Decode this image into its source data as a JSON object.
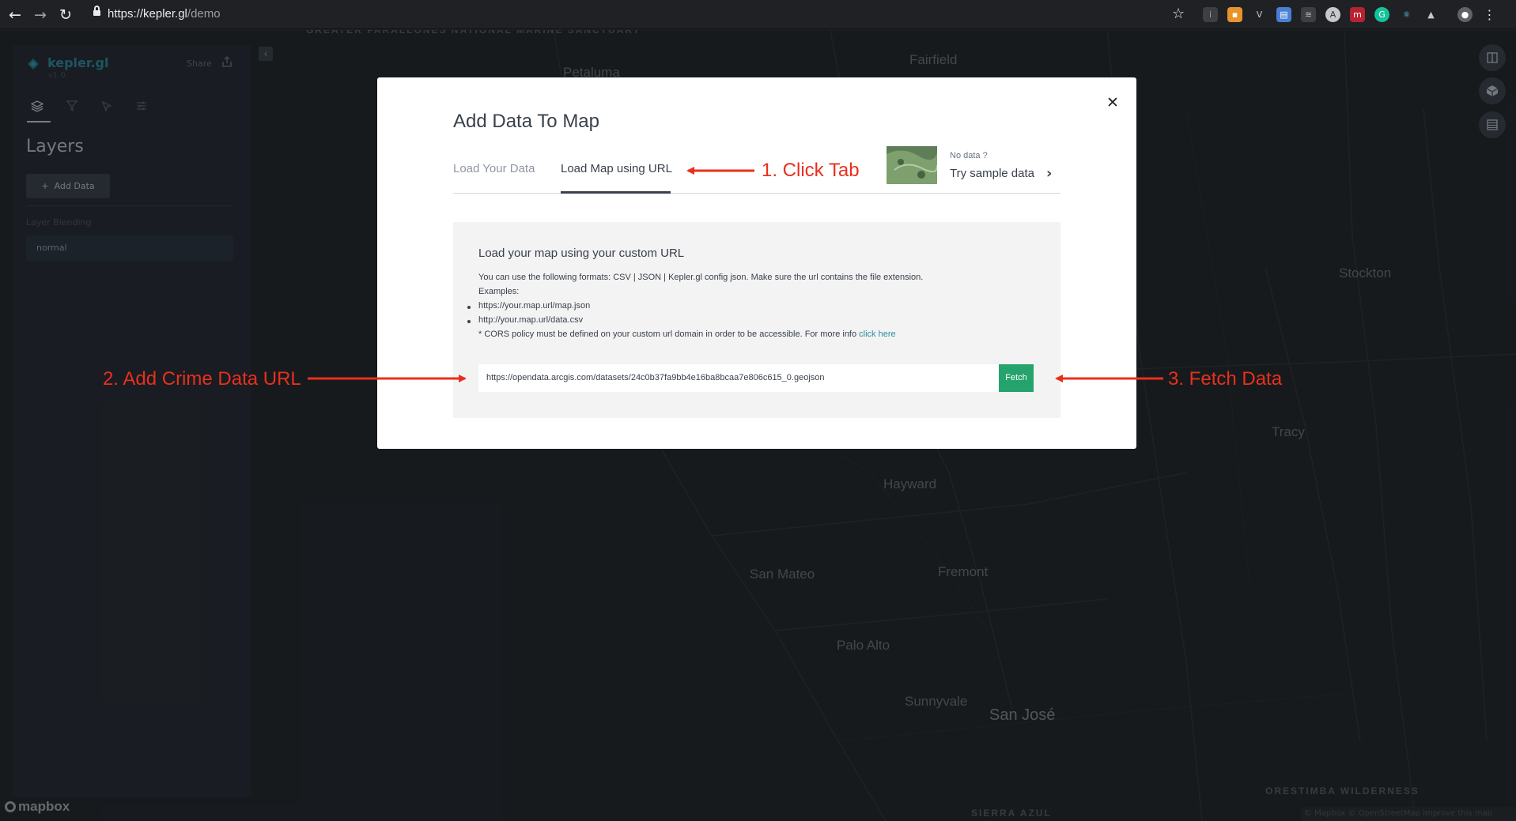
{
  "browser": {
    "url_host": "https://kepler.gl",
    "url_path": "/demo"
  },
  "map": {
    "places": {
      "farallones": "GREATER FARALLONES NATIONAL MARINE SANCTUARY",
      "petaluma": "Petaluma",
      "fairfield": "Fairfield",
      "stockton": "Stockton",
      "tracy": "Tracy",
      "hayward": "Hayward",
      "san_mateo": "San Mateo",
      "fremont": "Fremont",
      "palo_alto": "Palo Alto",
      "sunnyvale": "Sunnyvale",
      "san_jose": "San José",
      "orestimba": "ORESTIMBA WILDERNESS",
      "sierra": "SIERRA AZUL"
    },
    "logo": "mapbox",
    "attribution": "© Mapbox © OpenStreetMap Improve this map"
  },
  "sidebar": {
    "brand": "kepler.gl",
    "version": "v1.0",
    "share": "Share",
    "layers_title": "Layers",
    "add_data": "Add Data",
    "blend_label": "Layer Blending",
    "blend_value": "normal"
  },
  "modal": {
    "title": "Add Data To Map",
    "tabs": [
      "Load Your Data",
      "Load Map using URL"
    ],
    "sample": {
      "no_data": "No data ?",
      "try": "Try sample data"
    },
    "panel": {
      "title": "Load your map using your custom URL",
      "desc": "You can use the following formats: CSV | JSON | Kepler.gl config json. Make sure the url contains the file extension.",
      "examples_label": "Examples:",
      "examples": [
        "https://your.map.url/map.json",
        "http://your.map.url/data.csv"
      ],
      "cors": "* CORS policy must be defined on your custom url domain in order to be accessible. For more info",
      "cors_link": "click here",
      "input_value": "https://opendata.arcgis.com/datasets/24c0b37fa9bb4e16ba8bcaa7e806c615_0.geojson",
      "fetch": "Fetch"
    }
  },
  "annotations": {
    "step1": "1. Click Tab",
    "step2": "2. Add Crime Data URL",
    "step3": "3. Fetch Data"
  },
  "colors": {
    "annotation": "#e8301c",
    "fetch_button": "#24a36c",
    "brand": "#2c8ea0"
  }
}
